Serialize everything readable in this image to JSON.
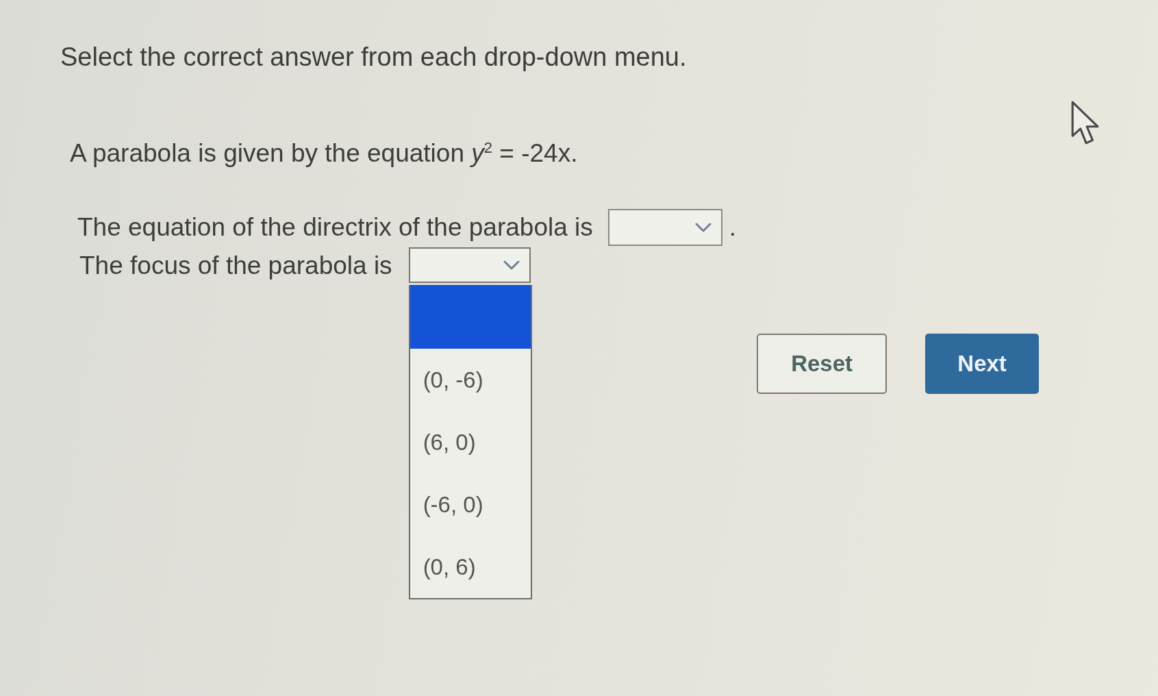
{
  "instruction": "Select the correct answer from each drop-down menu.",
  "question": "A parabola is given by the equation *y*$^{2}$ = -24x.",
  "items": [
    {
      "text_before": "The equation of the directrix of the parabola is",
      "dropdown": {
        "expanded": false
      },
      "text_after": "."
    },
    {
      "text_before": "The focus of the parabola is",
      "dropdown": {
        "expanded": true,
        "options": [
          {
            "kind": "blank",
            "selected": true
          },
          {
            "kind": "text",
            "label": "(0, -6)",
            "selected": false
          },
          {
            "kind": "text",
            "label": "(6, 0)",
            "selected": false
          },
          {
            "kind": "text",
            "label": "(-6, 0)",
            "selected": false
          },
          {
            "kind": "text",
            "label": "(0, 6)",
            "selected": false
          }
        ]
      }
    }
  ],
  "buttons": [
    {
      "kind": "secondary",
      "label": "Reset"
    },
    {
      "kind": "primary",
      "label": "Next"
    }
  ]
}
